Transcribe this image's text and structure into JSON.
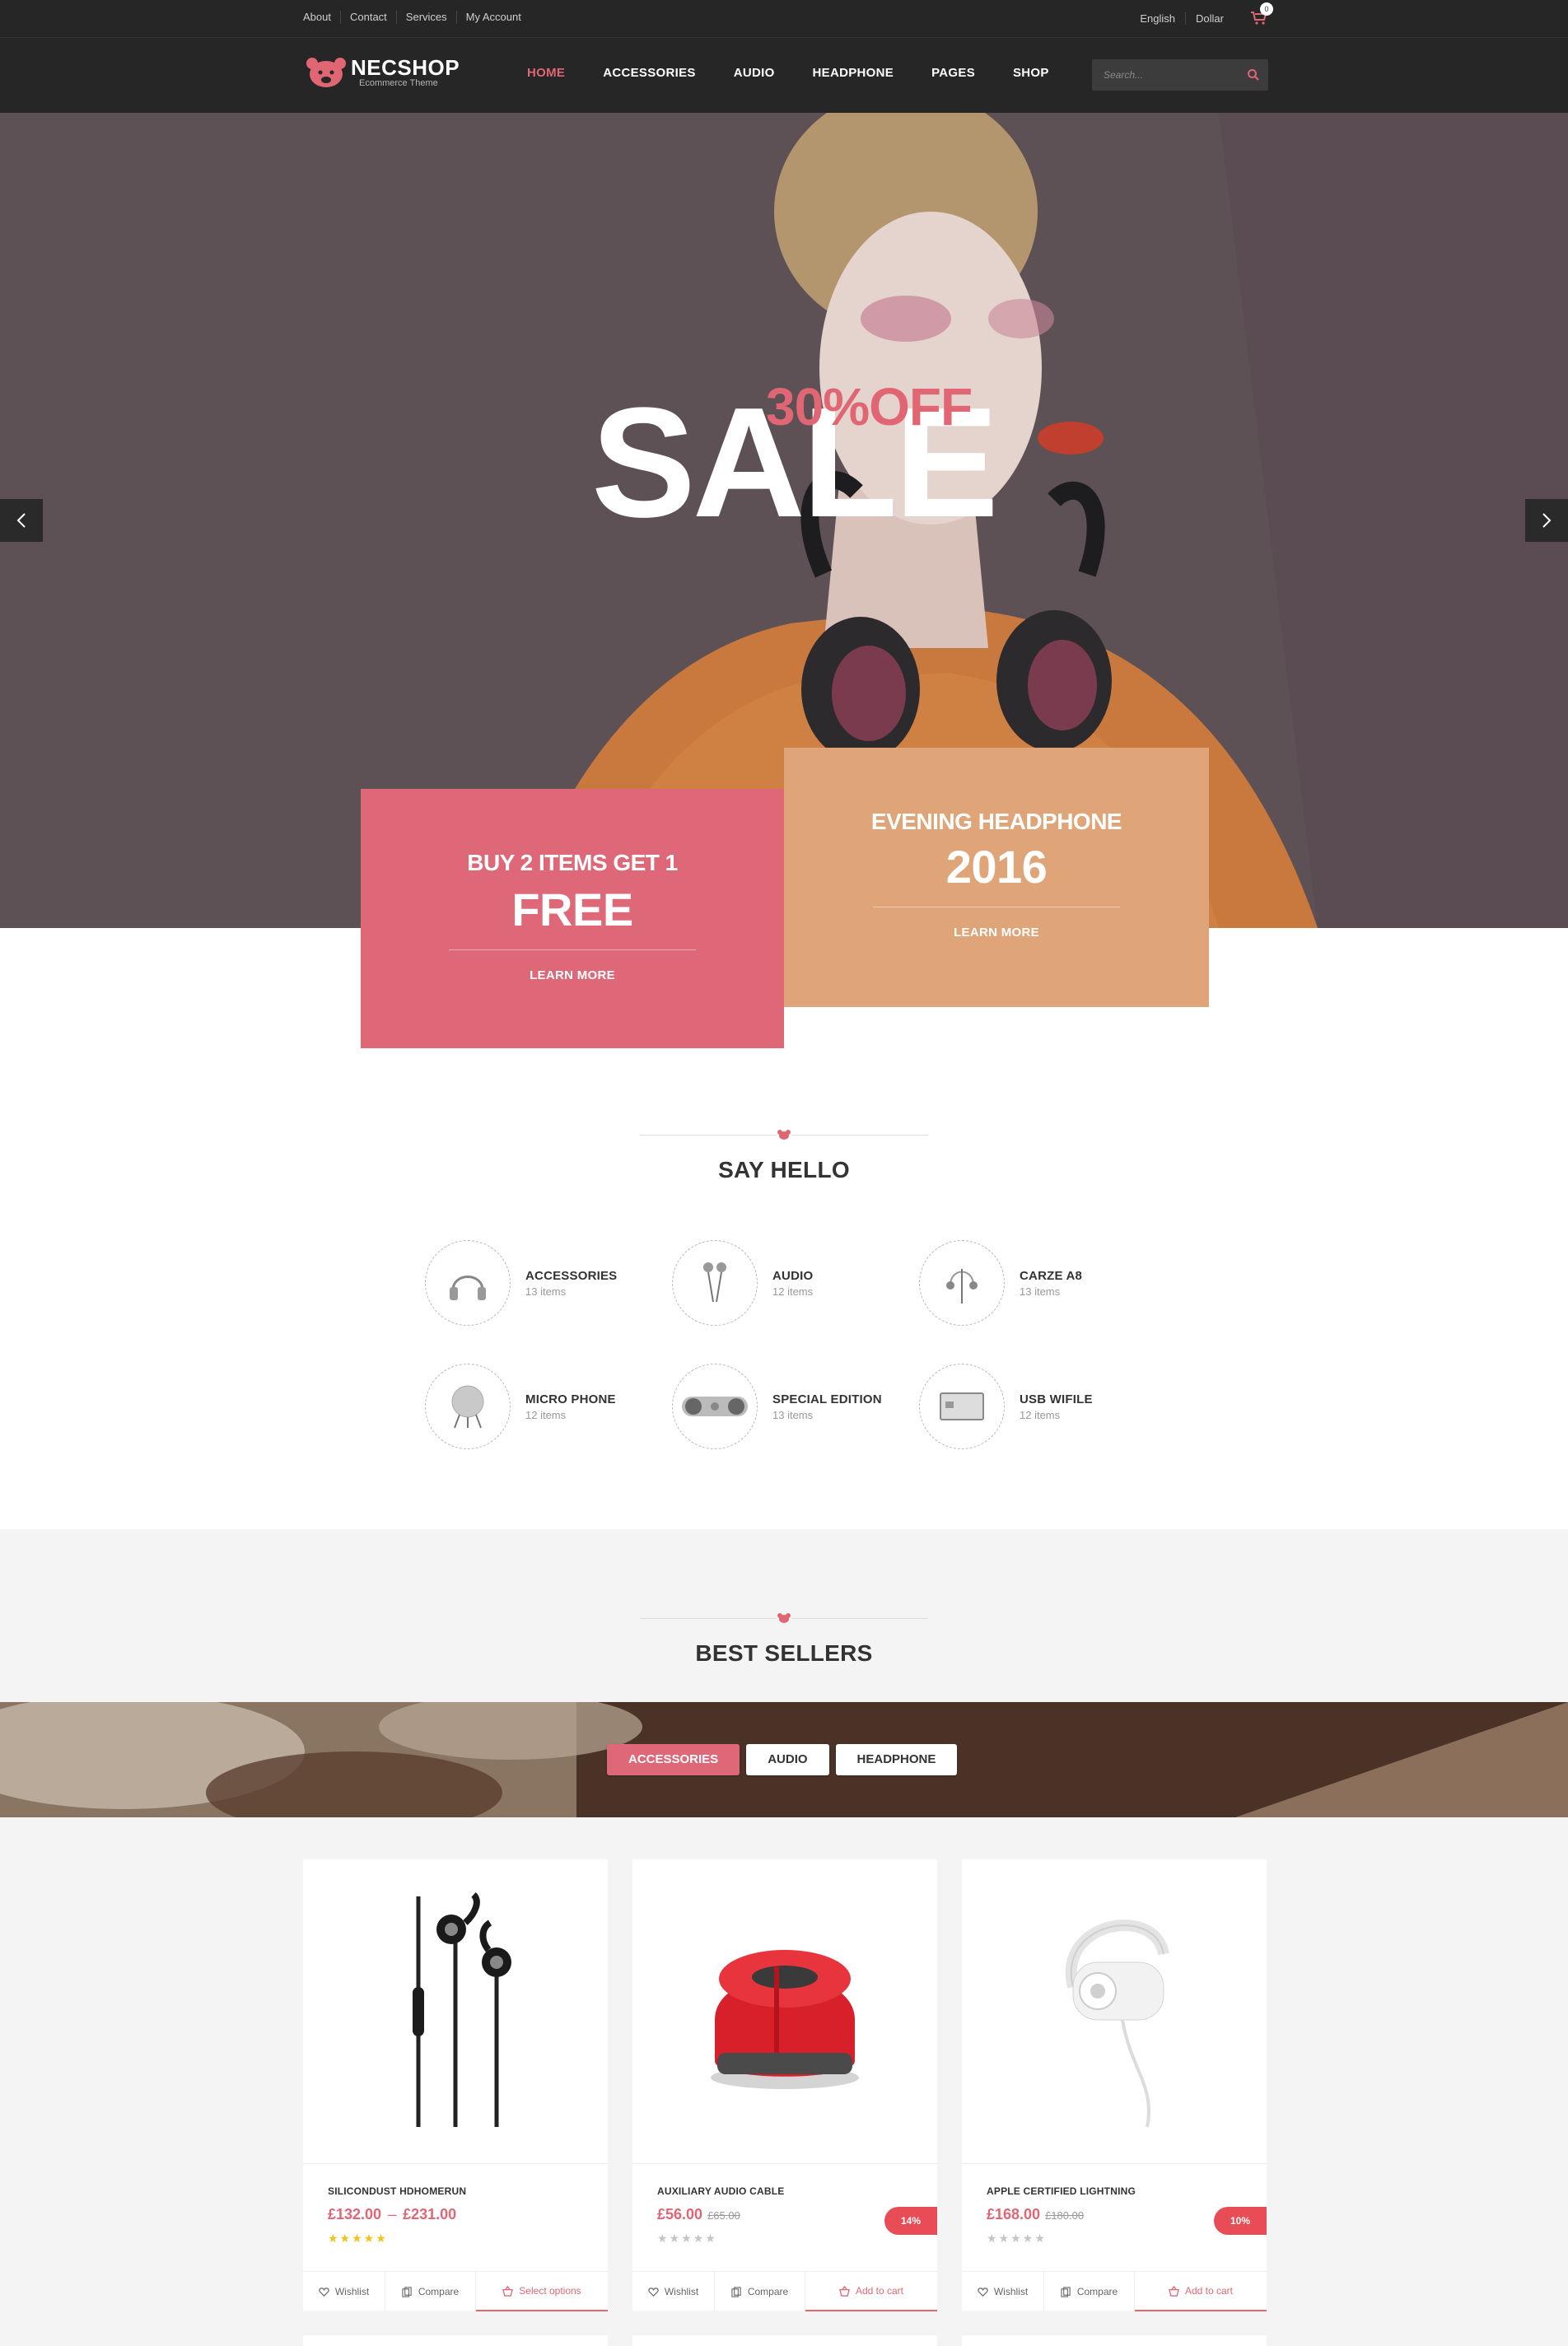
{
  "topbar": {
    "links": [
      "About",
      "Contact",
      "Services",
      "My Account"
    ],
    "language": "English",
    "currency": "Dollar",
    "cart_count": "0"
  },
  "header": {
    "logo_name": "NECSHOP",
    "logo_sub": "Ecommerce Theme",
    "nav": [
      "HOME",
      "ACCESSORIES",
      "AUDIO",
      "HEADPHONE",
      "PAGES",
      "SHOP"
    ],
    "active_nav": "HOME",
    "search_placeholder": "Search..."
  },
  "hero": {
    "headline": "SALE",
    "offer": "30%OFF"
  },
  "promos": [
    {
      "line1": "BUY 2 ITEMS GET 1",
      "line2": "FREE",
      "cta": "LEARN MORE",
      "color": "#de6877"
    },
    {
      "line1": "EVENING HEADPHONE",
      "line2": "2016",
      "cta": "LEARN MORE",
      "color": "#dfa478"
    }
  ],
  "say_hello": {
    "title": "SAY HELLO",
    "categories": [
      {
        "name": "ACCESSORIES",
        "count": "13 items",
        "icon": "headphones-icon"
      },
      {
        "name": "AUDIO",
        "count": "12 items",
        "icon": "earbuds-icon"
      },
      {
        "name": "CARZE A8",
        "count": "13 items",
        "icon": "earphones-icon"
      },
      {
        "name": "MICRO PHONE",
        "count": "12 items",
        "icon": "speaker-stand-icon"
      },
      {
        "name": "SPECIAL EDITION",
        "count": "13 items",
        "icon": "stereo-speaker-icon"
      },
      {
        "name": "USB WIFILE",
        "count": "12 items",
        "icon": "usb-card-icon"
      }
    ]
  },
  "best_sellers": {
    "title": "BEST SELLERS",
    "tabs": [
      "ACCESSORIES",
      "AUDIO",
      "HEADPHONE"
    ],
    "active_tab": "ACCESSORIES",
    "products": [
      {
        "name": "SILICONDUST HDHOMERUN",
        "price": "£132.00",
        "price_to": "£231.00",
        "old_price": "",
        "badge": "",
        "rating": 5,
        "cta": "Select options",
        "image": "black-earphones-image"
      },
      {
        "name": "AUXILIARY AUDIO CABLE",
        "price": "£56.00",
        "price_to": "",
        "old_price": "£65.00",
        "badge": "14%",
        "rating": 0,
        "cta": "Add to cart",
        "image": "red-speaker-image"
      },
      {
        "name": "APPLE CERTIFIED LIGHTNING",
        "price": "£168.00",
        "price_to": "",
        "old_price": "£180.00",
        "badge": "10%",
        "rating": 0,
        "cta": "Add to cart",
        "image": "white-earphone-image"
      }
    ],
    "wishlist_label": "Wishlist",
    "compare_label": "Compare"
  },
  "colors": {
    "accent": "#e06674",
    "dark": "#262626",
    "promo_pink": "#de6877",
    "promo_orange": "#dfa478",
    "hero_bg": "#5e5156"
  }
}
